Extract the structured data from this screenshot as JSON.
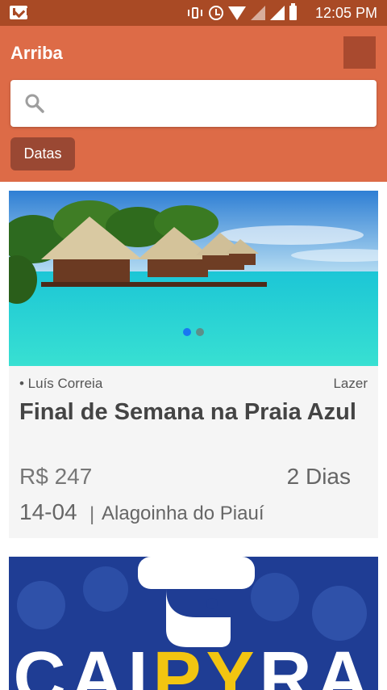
{
  "status_bar": {
    "time": "12:05 PM",
    "icons": [
      "gmail-icon",
      "vibrate-icon",
      "alarm-icon",
      "wifi-icon",
      "signal-icon",
      "battery-icon"
    ]
  },
  "app_bar": {
    "title": "Arriba",
    "search": {
      "value": "",
      "placeholder": ""
    },
    "filter_button": "Datas"
  },
  "cards": [
    {
      "location": "• Luís Correia",
      "category": "Lazer",
      "title": "Final de Semana na Praia Azul",
      "price": "R$ 247",
      "duration": "2 Dias",
      "date": "14-04",
      "separator": "|",
      "destination": "Alagoinha do Piauí",
      "carousel": {
        "total": 2,
        "active": 1
      }
    },
    {
      "banner_text": "CAIPYRA"
    }
  ],
  "colors": {
    "status_bar": "#a94a25",
    "app_bar": "#dd6b47",
    "button": "#9a4833",
    "card_bg": "#f5f5f5",
    "accent_dot": "#1877f2"
  }
}
